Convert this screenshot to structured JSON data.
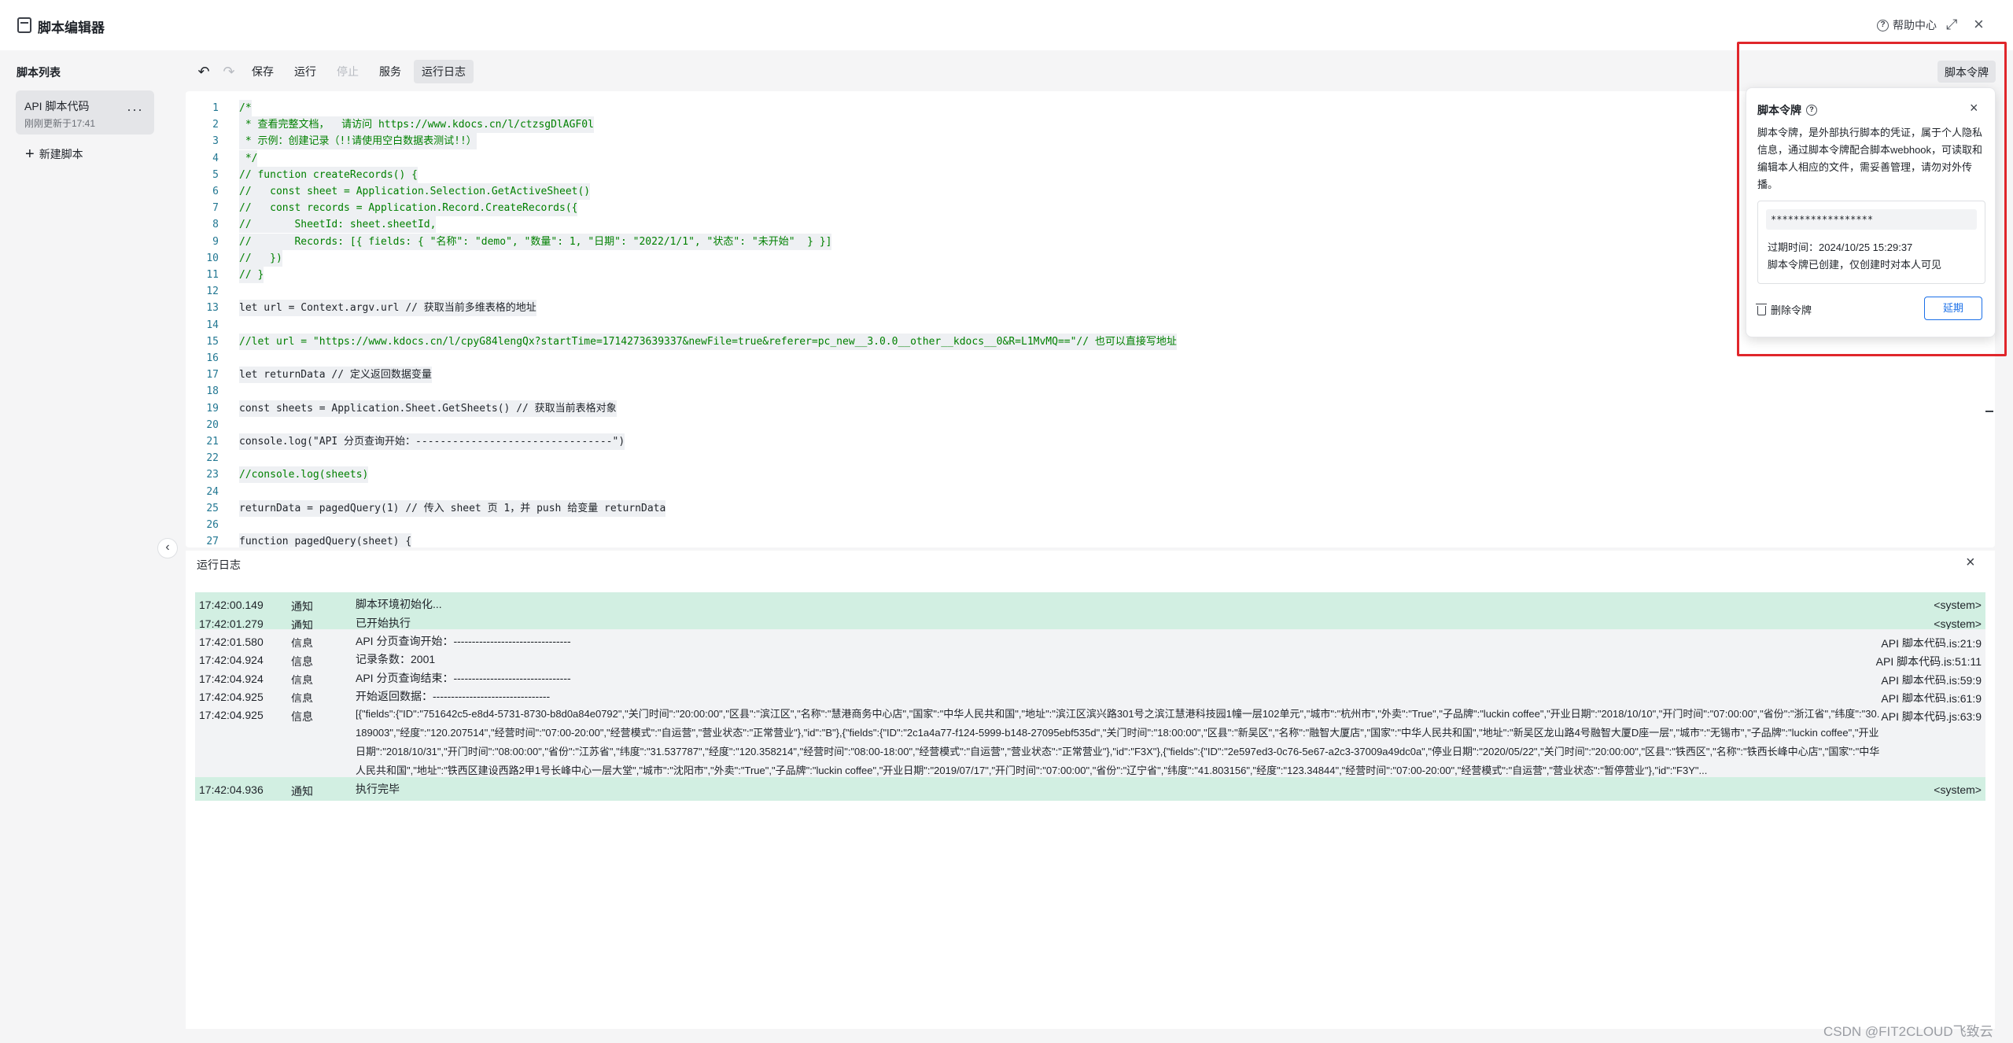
{
  "app": {
    "title": "脚本编辑器",
    "help": "帮助中心"
  },
  "sidebar": {
    "title": "脚本列表",
    "item": {
      "name": "API 脚本代码",
      "updated": "刚刚更新于17:41"
    },
    "new_script": "新建脚本"
  },
  "toolbar": {
    "save": "保存",
    "run": "运行",
    "stop": "停止",
    "service": "服务",
    "run_log": "运行日志",
    "token": "脚本令牌"
  },
  "editor": {
    "lines": [
      "/*",
      " * 查看完整文档，  请访问 https://www.kdocs.cn/l/ctzsgDlAGF0l",
      " * 示例：创建记录（!!请使用空白数据表测试!!）",
      " */",
      "// function createRecords() {",
      "//   const sheet = Application.Selection.GetActiveSheet()",
      "//   const records = Application.Record.CreateRecords({",
      "//       SheetId: sheet.sheetId,",
      "//       Records: [{ fields: { \"名称\": \"demo\", \"数量\": 1, \"日期\": \"2022/1/1\", \"状态\": \"未开始\"  } }]",
      "//   })",
      "// }",
      "",
      "let url = Context.argv.url // 获取当前多维表格的地址",
      "",
      "//let url = \"https://www.kdocs.cn/l/cpyG84lengQx?startTime=1714273639337&newFile=true&referer=pc_new__3.0.0__other__kdocs__0&R=L1MvMQ==\"// 也可以直接写地址",
      "",
      "let returnData // 定义返回数据变量",
      "",
      "const sheets = Application.Sheet.GetSheets() // 获取当前表格对象",
      "",
      "console.log(\"API 分页查询开始：--------------------------------\")",
      "",
      "//console.log(sheets)",
      "",
      "returnData = pagedQuery(1) // 传入 sheet 页 1，并 push 给变量 returnData",
      "",
      "function pagedQuery(sheet) {"
    ]
  },
  "log": {
    "title": "运行日志",
    "rows": [
      {
        "time": "17:42:00.149",
        "level": "通知",
        "message": "脚本环境初始化...",
        "source": "<system>",
        "kind": "notice"
      },
      {
        "time": "17:42:01.279",
        "level": "通知",
        "message": "已开始执行",
        "source": "<system>",
        "kind": "notice"
      },
      {
        "time": "17:42:01.580",
        "level": "信息",
        "message": "API 分页查询开始：--------------------------------",
        "source": "API 脚本代码.js:21:9",
        "kind": "info"
      },
      {
        "time": "17:42:04.924",
        "level": "信息",
        "message": " 记录条数：2001",
        "source": "API 脚本代码.js:51:11",
        "kind": "info"
      },
      {
        "time": "17:42:04.924",
        "level": "信息",
        "message": " API 分页查询结束：--------------------------------",
        "source": "API 脚本代码.js:59:9",
        "kind": "info"
      },
      {
        "time": "17:42:04.925",
        "level": "信息",
        "message": " 开始返回数据：--------------------------------",
        "source": "API 脚本代码.js:61:9",
        "kind": "info"
      },
      {
        "time": "17:42:04.925",
        "level": "信息",
        "message": " [{\"fields\":{\"ID\":\"751642c5-e8d4-5731-8730-b8d0a84e0792\",\"关门时间\":\"20:00:00\",\"区县\":\"滨江区\",\"名称\":\"慧港商务中心店\",\"国家\":\"中华人民共和国\",\"地址\":\"滨江区滨兴路301号之滨江慧港科技园1幢一层102单元\",\"城市\":\"杭州市\",\"外卖\":\"True\",\"子品牌\":\"luckin coffee\",\"开业日期\":\"2018/10/10\",\"开门时间\":\"07:00:00\",\"省份\":\"浙江省\",\"纬度\":\"30.189003\",\"经度\":\"120.207514\",\"经营时间\":\"07:00-20:00\",\"经营模式\":\"自运营\",\"营业状态\":\"正常营业\"},\"id\":\"B\"},{\"fields\":{\"ID\":\"2c1a4a77-f124-5999-b148-27095ebf535d\",\"关门时间\":\"18:00:00\",\"区县\":\"新吴区\",\"名称\":\"融智大厦店\",\"国家\":\"中华人民共和国\",\"地址\":\"新吴区龙山路4号融智大厦D座一层\",\"城市\":\"无锡市\",\"子品牌\":\"luckin coffee\",\"开业日期\":\"2018/10/31\",\"开门时间\":\"08:00:00\",\"省份\":\"江苏省\",\"纬度\":\"31.537787\",\"经度\":\"120.358214\",\"经营时间\":\"08:00-18:00\",\"经营模式\":\"自运营\",\"营业状态\":\"正常营业\"},\"id\":\"F3X\"},{\"fields\":{\"ID\":\"2e597ed3-0c76-5e67-a2c3-37009a49dc0a\",\"停业日期\":\"2020/05/22\",\"关门时间\":\"20:00:00\",\"区县\":\"铁西区\",\"名称\":\"铁西长峰中心店\",\"国家\":\"中华人民共和国\",\"地址\":\"铁西区建设西路2甲1号长峰中心一层大堂\",\"城市\":\"沈阳市\",\"外卖\":\"True\",\"子品牌\":\"luckin coffee\",\"开业日期\":\"2019/07/17\",\"开门时间\":\"07:00:00\",\"省份\":\"辽宁省\",\"纬度\":\"41.803156\",\"经度\":\"123.34844\",\"经营时间\":\"07:00-20:00\",\"经营模式\":\"自运营\",\"营业状态\":\"暂停营业\"},\"id\":\"F3Y\"...",
        "source": "API 脚本代码.js:63:9",
        "kind": "info"
      },
      {
        "time": "17:42:04.936",
        "level": "通知",
        "message": "执行完毕",
        "source": "<system>",
        "kind": "notice"
      }
    ]
  },
  "token_popover": {
    "title": "脚本令牌",
    "description": "脚本令牌，是外部执行脚本的凭证，属于个人隐私信息，通过脚本令牌配合脚本webhook，可读取和编辑本人相应的文件，需妥善管理，请勿对外传播。",
    "token_value": "******************",
    "expiry": "过期时间：2024/10/25 15:29:37",
    "note": "脚本令牌已创建，仅创建时对本人可见",
    "delete": "删除令牌",
    "extend": "延期"
  },
  "watermark": "CSDN @FIT2CLOUD飞致云",
  "colors": {
    "accent": "#1a6fe8",
    "notice_row": "#d2efe2",
    "highlight": "#e0262b"
  }
}
